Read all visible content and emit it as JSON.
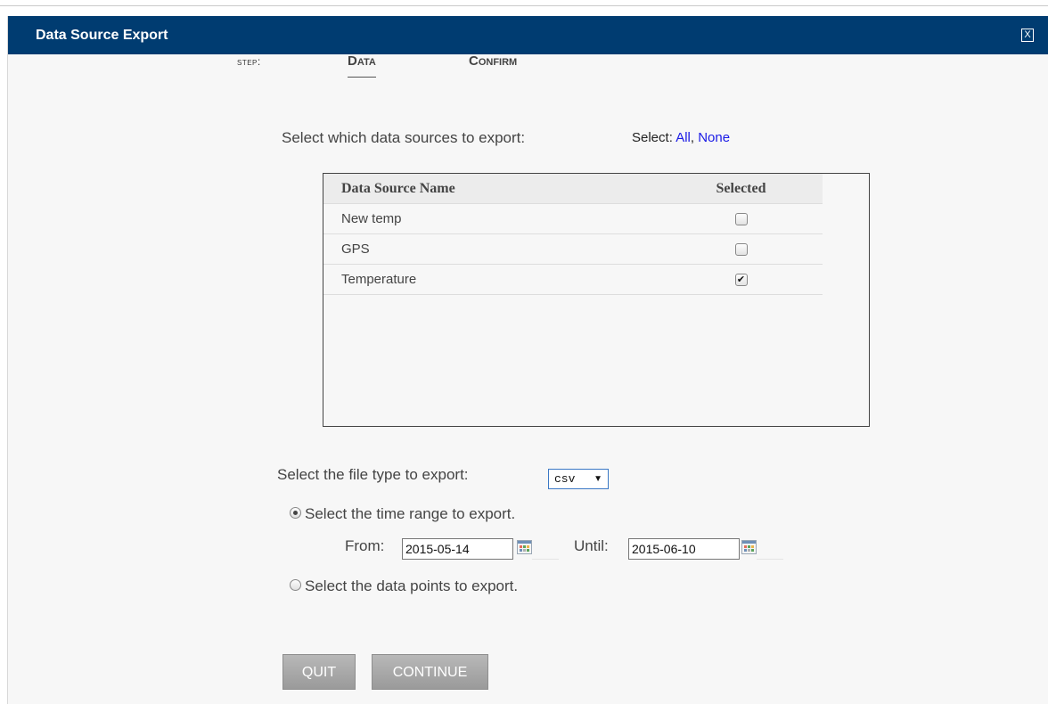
{
  "dialog": {
    "title": "Data Source Export",
    "close_label": "X"
  },
  "steps": {
    "label": "step:",
    "items": [
      "Data",
      "Confirm"
    ],
    "active": "Data"
  },
  "sources": {
    "prompt": "Select which data sources to export:",
    "select_prefix": "Select:",
    "select_all": "All",
    "select_separator": ",",
    "select_none": "None",
    "columns": [
      "Data Source Name",
      "Selected"
    ],
    "rows": [
      {
        "name": "New temp",
        "selected": false
      },
      {
        "name": "GPS",
        "selected": false
      },
      {
        "name": "Temperature",
        "selected": true
      }
    ]
  },
  "filetype": {
    "prompt": "Select the file type to export:",
    "value": "csv"
  },
  "range": {
    "time_option": "Select the time range to export.",
    "time_selected": true,
    "from_label": "From:",
    "from_value": "2015-05-14",
    "until_label": "Until:",
    "until_value": "2015-06-10",
    "points_option": "Select the data points to export.",
    "points_selected": false
  },
  "buttons": {
    "quit": "QUIT",
    "continue": "CONTINUE"
  },
  "colors": {
    "titlebar": "#003c71",
    "link": "#1a1ae6",
    "button": "#a8a8a8"
  }
}
